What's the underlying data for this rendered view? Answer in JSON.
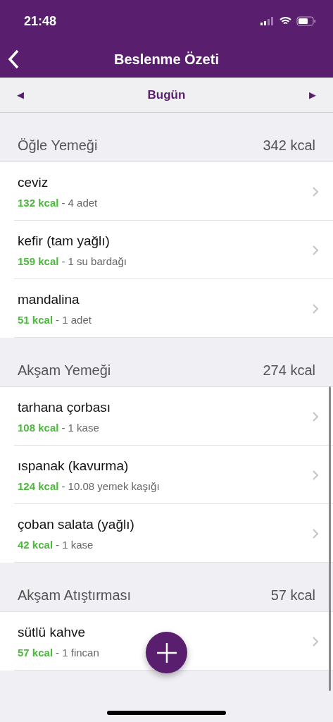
{
  "status_bar": {
    "time": "21:48"
  },
  "nav": {
    "title": "Beslenme Özeti"
  },
  "date_bar": {
    "prev": "◀",
    "label": "Bugün",
    "next": "▶"
  },
  "meals": [
    {
      "name": "Öğle Yemeği",
      "total": "342 kcal",
      "items": [
        {
          "name": "ceviz",
          "kcal": "132 kcal",
          "amount": "- 4 adet"
        },
        {
          "name": "kefir (tam yağlı)",
          "kcal": "159 kcal",
          "amount": "- 1 su bardağı"
        },
        {
          "name": "mandalina",
          "kcal": "51 kcal",
          "amount": "- 1 adet"
        }
      ]
    },
    {
      "name": "Akşam Yemeği",
      "total": "274 kcal",
      "items": [
        {
          "name": "tarhana çorbası",
          "kcal": "108 kcal",
          "amount": "- 1 kase"
        },
        {
          "name": "ıspanak (kavurma)",
          "kcal": "124 kcal",
          "amount": "- 10.08 yemek kaşığı"
        },
        {
          "name": "çoban salata (yağlı)",
          "kcal": "42 kcal",
          "amount": "- 1 kase"
        }
      ]
    },
    {
      "name": "Akşam Atıştırması",
      "total": "57 kcal",
      "items": [
        {
          "name": "sütlü kahve",
          "kcal": "57 kcal",
          "amount": "- 1 fincan"
        }
      ]
    }
  ]
}
